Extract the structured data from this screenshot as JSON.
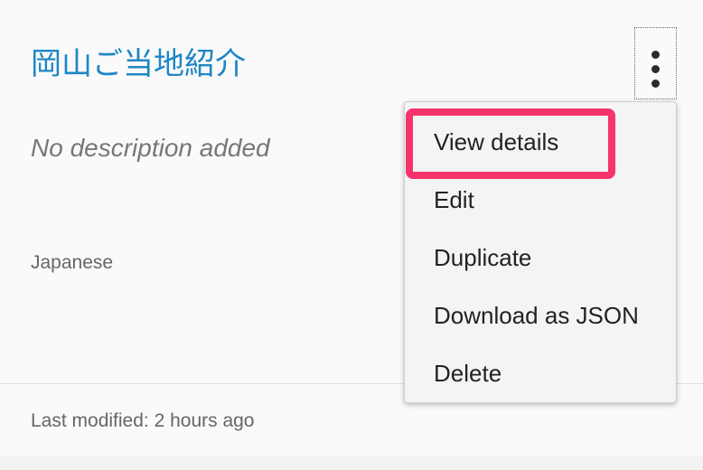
{
  "card": {
    "title": "岡山ご当地紹介",
    "description": "No description added",
    "language": "Japanese",
    "last_modified": "Last modified: 2 hours ago"
  },
  "menu": {
    "items": [
      {
        "label": "View details",
        "highlighted": true
      },
      {
        "label": "Edit"
      },
      {
        "label": "Duplicate"
      },
      {
        "label": "Download as JSON"
      },
      {
        "label": "Delete"
      }
    ]
  },
  "colors": {
    "title": "#1f86c4",
    "highlight": "#f7336c",
    "menu_background": "#f4f4f4",
    "card_background": "#fafafa"
  },
  "icons": {
    "more_options": "vertical-ellipsis-icon"
  }
}
